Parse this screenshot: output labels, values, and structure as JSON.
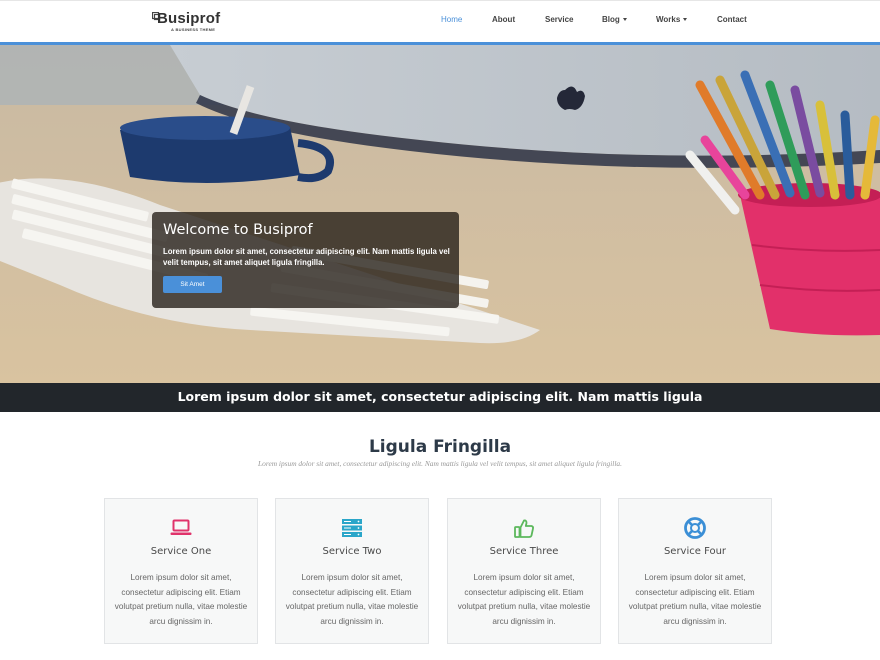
{
  "brand": {
    "name": "Busiprof",
    "tagline": "A BUSINESS THEME"
  },
  "nav": {
    "items": [
      {
        "label": "Home",
        "active": true
      },
      {
        "label": "About"
      },
      {
        "label": "Service"
      },
      {
        "label": "Blog",
        "dropdown": true
      },
      {
        "label": "Works",
        "dropdown": true
      },
      {
        "label": "Contact"
      }
    ]
  },
  "colors": {
    "accent": "#4a90d9",
    "strip": "#22262b",
    "service_icons": [
      "#e0336b",
      "#2aa6c9",
      "#5cb85c",
      "#3b8fd6"
    ]
  },
  "hero": {
    "title": "Welcome to Busiprof",
    "text": "Lorem ipsum dolor sit amet, consectetur adipiscing elit. Nam mattis ligula vel velit tempus, sit amet aliquet ligula fringilla.",
    "button": "Sit Amet"
  },
  "strip": {
    "text": "Lorem ipsum dolor sit amet, consectetur adipiscing elit. Nam mattis ligula"
  },
  "section": {
    "title": "Ligula Fringilla",
    "subtitle": "Lorem ipsum dolor sit amet, consectetur adipiscing elit. Nam mattis ligula vel velit tempus, sit amet aliquet ligula fringilla."
  },
  "services": [
    {
      "title": "Service One",
      "icon": "laptop-icon",
      "text": "Lorem ipsum dolor sit amet, consectetur adipiscing elit. Etiam volutpat pretium nulla, vitae molestie arcu dignissim in."
    },
    {
      "title": "Service Two",
      "icon": "server-icon",
      "text": "Lorem ipsum dolor sit amet, consectetur adipiscing elit. Etiam volutpat pretium nulla, vitae molestie arcu dignissim in."
    },
    {
      "title": "Service Three",
      "icon": "thumbs-up-icon",
      "text": "Lorem ipsum dolor sit amet, consectetur adipiscing elit. Etiam volutpat pretium nulla, vitae molestie arcu dignissim in."
    },
    {
      "title": "Service Four",
      "icon": "lifebuoy-icon",
      "text": "Lorem ipsum dolor sit amet, consectetur adipiscing elit. Etiam volutpat pretium nulla, vitae molestie arcu dignissim in."
    }
  ]
}
